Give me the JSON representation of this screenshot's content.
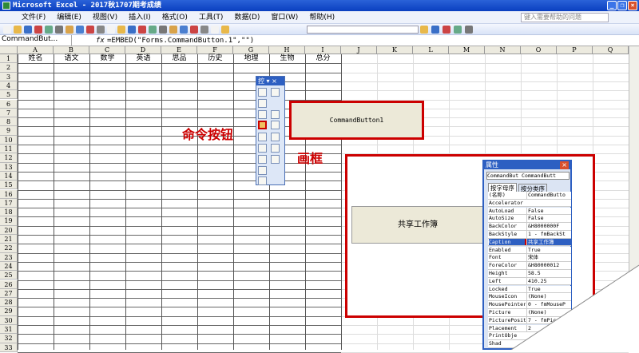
{
  "window": {
    "title": "Microsoft Excel - 2017秋1707期考成绩"
  },
  "menu": [
    "文件(F)",
    "编辑(E)",
    "视图(V)",
    "插入(I)",
    "格式(O)",
    "工具(T)",
    "数据(D)",
    "窗口(W)",
    "帮助(H)"
  ],
  "help_placeholder": "键入需要帮助的问题",
  "formula": {
    "name_box": "CommandBut...",
    "fx": "fx",
    "value": "=EMBED(\"Forms.CommandButton.1\",\"\")"
  },
  "columns": [
    "A",
    "B",
    "C",
    "D",
    "E",
    "F",
    "G",
    "H",
    "I",
    "J",
    "K",
    "L",
    "M",
    "N",
    "O",
    "P",
    "Q"
  ],
  "row_count": 33,
  "row1": [
    "姓名",
    "语文",
    "数学",
    "英语",
    "思品",
    "历史",
    "地理",
    "生物",
    "总分"
  ],
  "toolbox": {
    "title": "控"
  },
  "command_button": "CommandButton1",
  "annotations": {
    "command_button": "命令按钮",
    "frame": "画框"
  },
  "share_button": "共享工作簿",
  "properties": {
    "title": "属性",
    "object": "CommandBut CommandButt",
    "tabs": [
      "按字母序",
      "按分类序"
    ],
    "rows": [
      [
        "(名称)",
        "CommandButto"
      ],
      [
        "Accelerator",
        ""
      ],
      [
        "AutoLoad",
        "False"
      ],
      [
        "AutoSize",
        "False"
      ],
      [
        "BackColor",
        "&H8000000F"
      ],
      [
        "BackStyle",
        "1 - fmBackSt"
      ],
      [
        "Caption",
        "共享工作簿"
      ],
      [
        "Enabled",
        "True"
      ],
      [
        "Font",
        "宋体"
      ],
      [
        "ForeColor",
        "&H80000012"
      ],
      [
        "Height",
        "58.5"
      ],
      [
        "Left",
        "410.25"
      ],
      [
        "Locked",
        "True"
      ],
      [
        "MouseIcon",
        "(None)"
      ],
      [
        "MousePointer",
        "0 - fmMouseP"
      ],
      [
        "Picture",
        "(None)"
      ],
      [
        "PicturePosit",
        "7 - fmPic"
      ],
      [
        "Placement",
        "2"
      ],
      [
        "PrintObje",
        ""
      ],
      [
        "Shad",
        ""
      ]
    ]
  }
}
